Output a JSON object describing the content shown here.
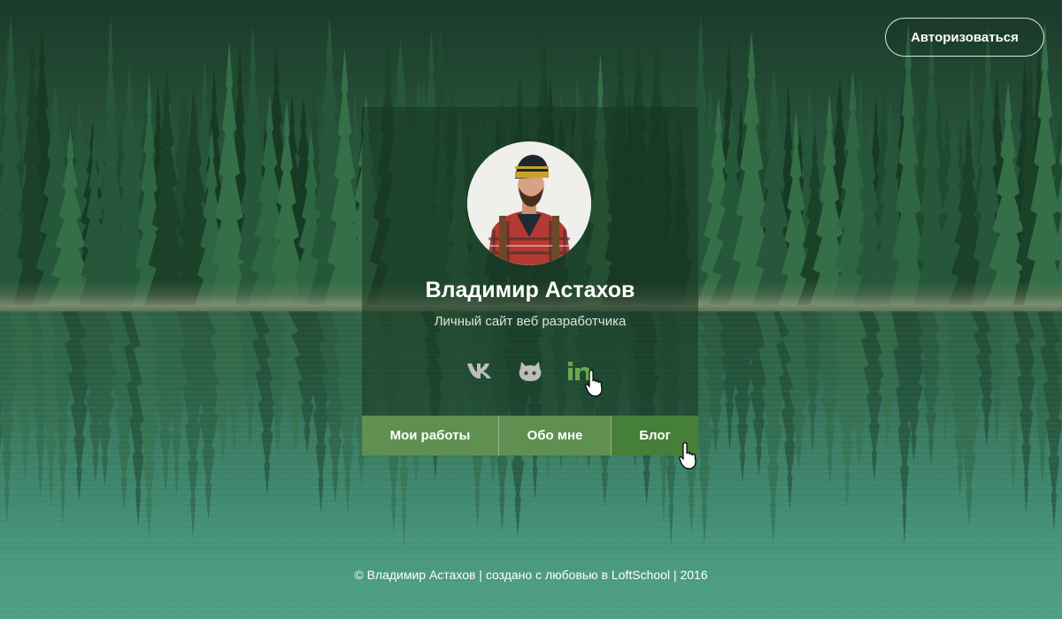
{
  "header": {
    "auth_button_label": "Авторизоваться"
  },
  "profile": {
    "name": "Владимир Астахов",
    "subtitle": "Личный сайт веб разработчика",
    "avatar_icon": "person-avatar"
  },
  "socials": [
    {
      "icon": "vk-icon",
      "active": false
    },
    {
      "icon": "github-icon",
      "active": false
    },
    {
      "icon": "linkedin-icon",
      "active": true
    }
  ],
  "nav": {
    "items": [
      {
        "label": "Мои работы"
      },
      {
        "label": "Обо мне"
      },
      {
        "label": "Блог",
        "active": true
      }
    ]
  },
  "footer": {
    "text": "© Владимир Астахов | создано с любовью в LoftSchool | 2016"
  },
  "colors": {
    "accent": "#467f3a",
    "nav_button": "#5f9052",
    "social_inactive": "#bdbdbd",
    "social_active": "#6aa84f",
    "text": "#ffffff"
  }
}
